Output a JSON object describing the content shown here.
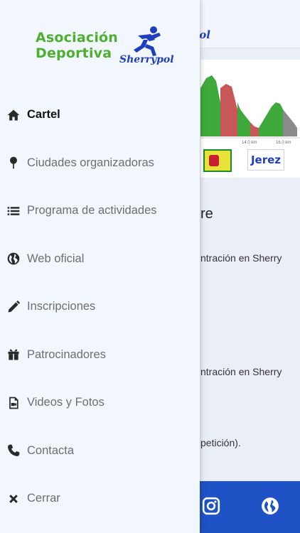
{
  "drawer": {
    "logo": {
      "line1": "Asociación",
      "line2": "Deportiva",
      "brand": "Sherrypol"
    },
    "menu": [
      {
        "label": "Cartel",
        "icon": "home-icon",
        "active": true
      },
      {
        "label": "Ciudades organizadoras",
        "icon": "map-pin-icon",
        "active": false
      },
      {
        "label": "Programa de actividades",
        "icon": "list-icon",
        "active": false
      },
      {
        "label": "Web oficial",
        "icon": "globe-icon",
        "active": false
      },
      {
        "label": "Inscripciones",
        "icon": "pencil-icon",
        "active": false
      },
      {
        "label": "Patrocinadores",
        "icon": "gift-icon",
        "active": false
      },
      {
        "label": "Videos y Fotos",
        "icon": "video-file-icon",
        "active": false
      },
      {
        "label": "Contacta",
        "icon": "phone-icon",
        "active": false
      },
      {
        "label": "Cerrar",
        "icon": "close-icon",
        "active": false
      }
    ]
  },
  "background": {
    "header_brand_fragment": "pol",
    "chart_ticks": [
      "14.0 km",
      "16.0 km"
    ],
    "sponsor_text": "Jerez",
    "heading_fragment": "re",
    "text_lines": [
      "ntración en Sherry",
      "ntración en Sherry",
      "petición)."
    ]
  },
  "colors": {
    "accent_blue": "#1f52c4",
    "logo_green": "#4caf2f",
    "drawer_bg": "#f2f7fd"
  }
}
